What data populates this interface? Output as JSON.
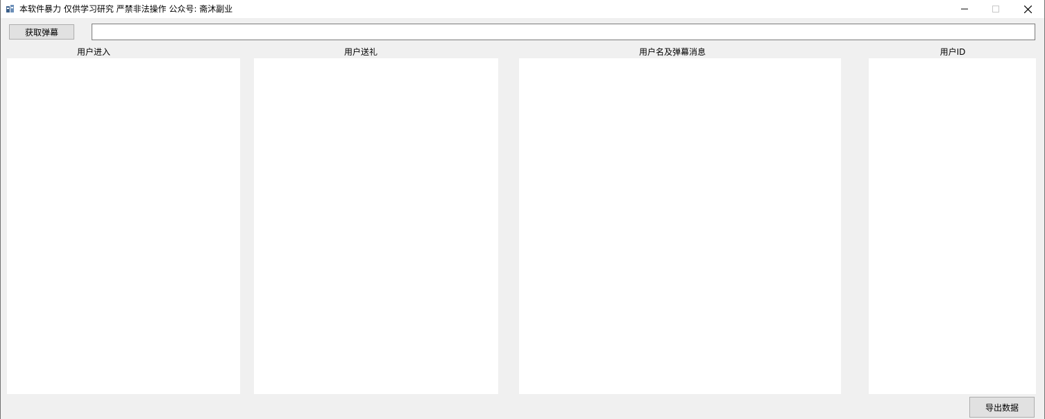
{
  "window": {
    "title": "本软件暴力 仅供学习研究 严禁非法操作  公众号: 斋沐副业",
    "app_icon": "app-icon",
    "controls": {
      "minimize": "minimize-icon",
      "maximize": "maximize-icon",
      "close": "close-icon"
    }
  },
  "toolbar": {
    "fetch_label": "获取弹幕",
    "url_value": "",
    "url_placeholder": ""
  },
  "columns": [
    {
      "label": "用户进入",
      "items": []
    },
    {
      "label": "用户送礼",
      "items": []
    },
    {
      "label": "用户名及弹幕消息",
      "items": []
    },
    {
      "label": "用户ID",
      "items": []
    }
  ],
  "footer": {
    "export_label": "导出数据"
  }
}
